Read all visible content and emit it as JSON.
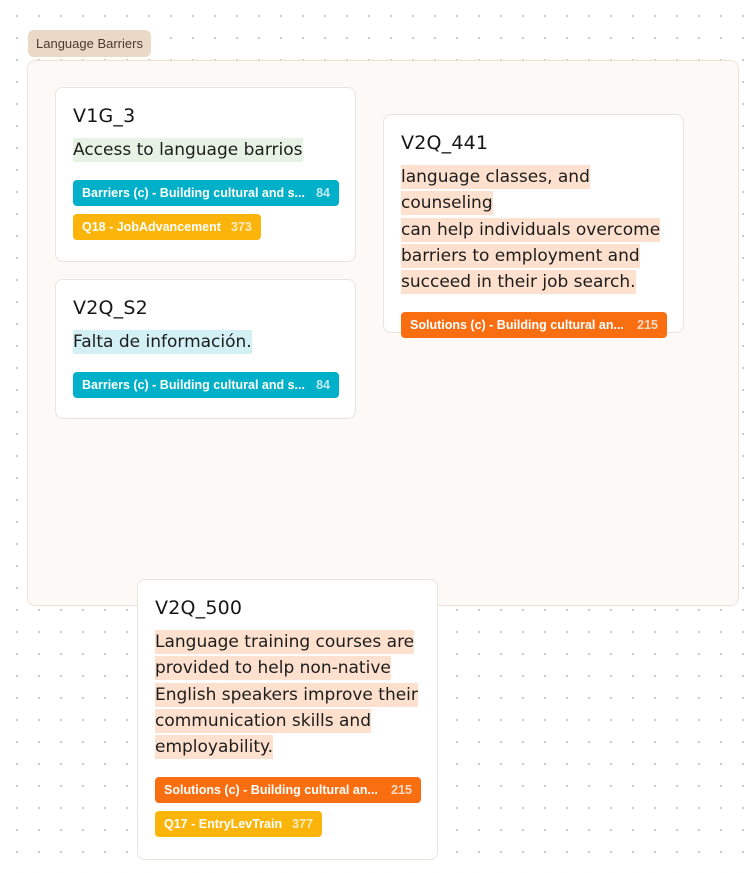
{
  "group": {
    "label": "Language Barriers"
  },
  "cards": [
    {
      "id": "V1G_3",
      "text": "Access to language barrios",
      "tags": [
        {
          "label": "Barriers (c) - Building cultural and s...",
          "count": "84",
          "color": "#00b0c8"
        },
        {
          "label": "Q18 - JobAdvancement",
          "count": "373",
          "color": "#fbb50a"
        }
      ]
    },
    {
      "id": "V2Q_S2",
      "text": "Falta de información.",
      "tags": [
        {
          "label": "Barriers (c) - Building cultural and s...",
          "count": "84",
          "color": "#00b0c8"
        }
      ]
    },
    {
      "id": "V2Q_441",
      "text_lines": [
        "language classes, and counseling",
        "can help individuals overcome",
        "barriers to employment and",
        "succeed in their job search."
      ],
      "tags": [
        {
          "label": "Solutions (c) - Building cultural an...",
          "count": "215",
          "color": "#fa6e12"
        }
      ]
    },
    {
      "id": "V2Q_500",
      "text_lines": [
        "Language training courses are",
        "provided to help non-native",
        "English speakers improve their",
        "communication skills and",
        "employability."
      ],
      "tags": [
        {
          "label": "Solutions (c) - Building cultural an...",
          "count": "215",
          "color": "#fa6e12"
        },
        {
          "label": "Q17 - EntryLevTrain",
          "count": "377",
          "color": "#fbb50a"
        }
      ]
    }
  ]
}
